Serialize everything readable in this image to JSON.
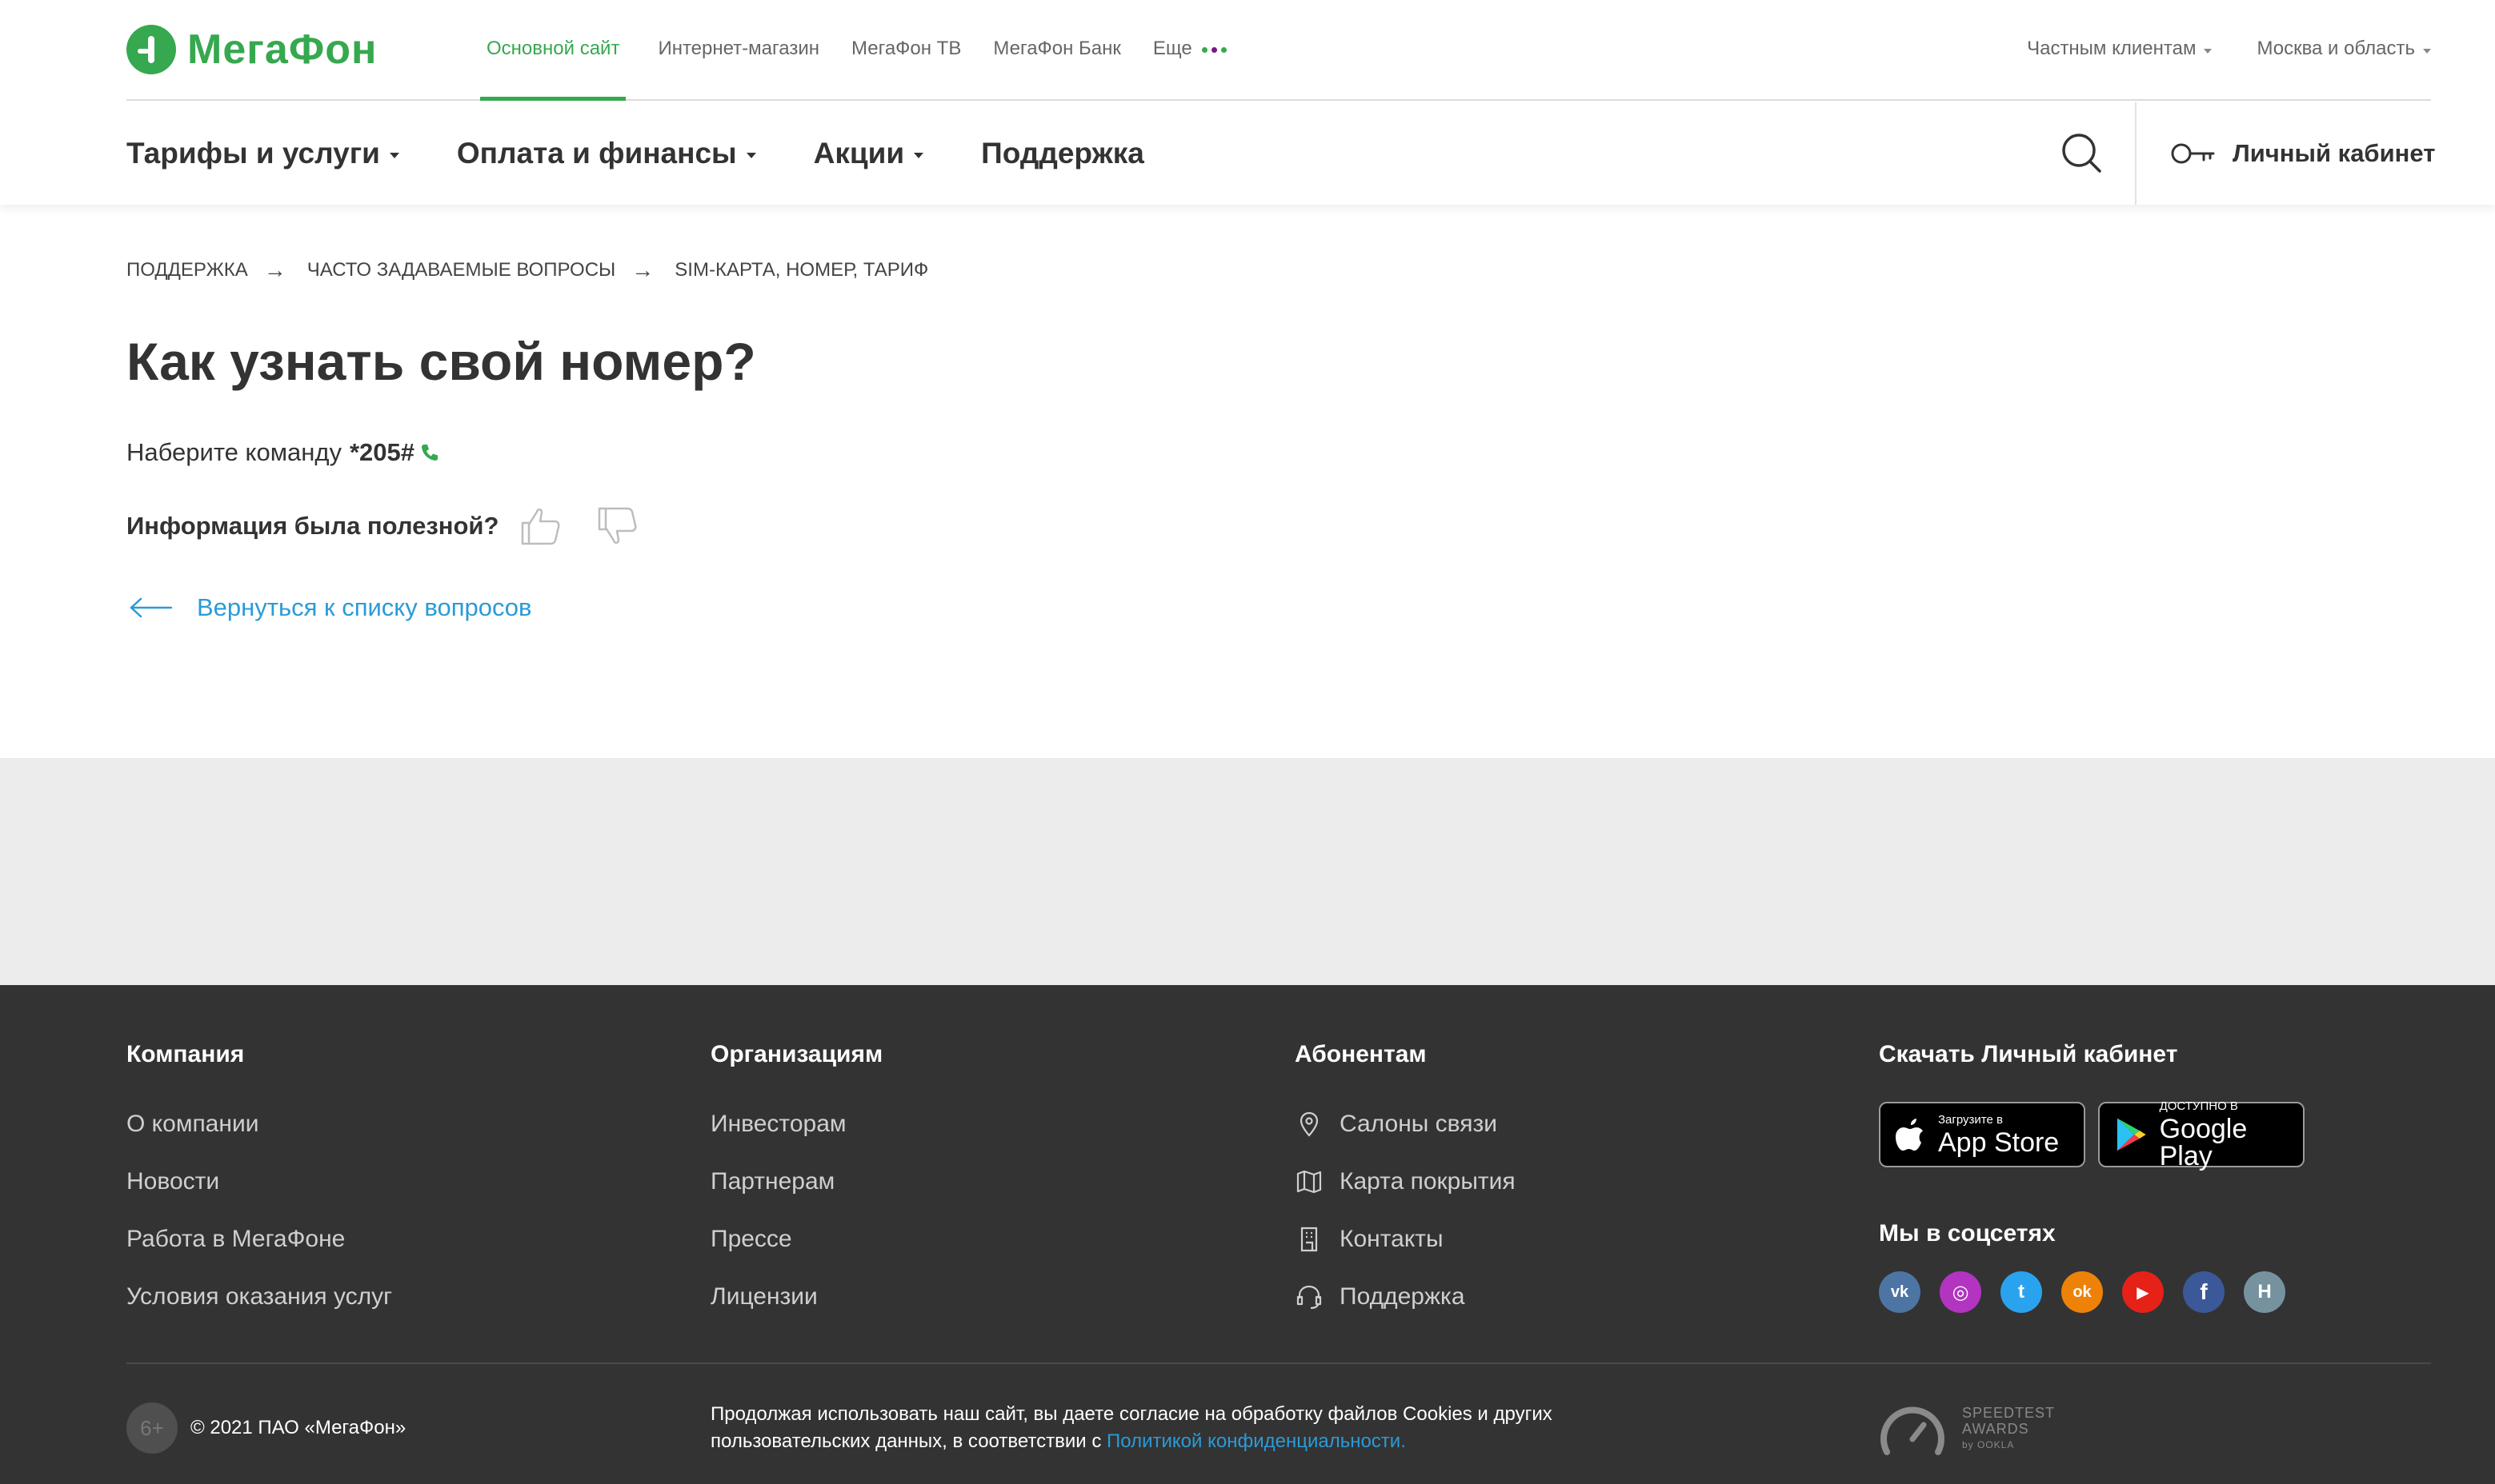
{
  "brand": {
    "name": "МегаФон",
    "green": "#36a84f",
    "purple": "#731982",
    "link_blue": "#2a9bd8"
  },
  "topnav": {
    "items": [
      "Основной сайт",
      "Интернет-магазин",
      "МегаФон ТВ",
      "МегаФон Банк",
      "Еще"
    ],
    "active": "Основной сайт"
  },
  "topright": {
    "segment": "Частным клиентам",
    "region": "Москва и область"
  },
  "mainnav": {
    "items": [
      "Тарифы и услуги",
      "Оплата и финансы",
      "Акции",
      "Поддержка"
    ],
    "account": "Личный кабинет"
  },
  "breadcrumb": [
    "ПОДДЕРЖКА",
    "ЧАСТО ЗАДАВАЕМЫЕ ВОПРОСЫ",
    "SIM-КАРТА, НОМЕР, ТАРИФ"
  ],
  "article": {
    "title": "Как узнать свой номер?",
    "answer_prefix": "Наберите команду",
    "command": "*205#",
    "feedback_question": "Информация была полезной?",
    "back_link": "Вернуться к списку вопросов"
  },
  "footer": {
    "columns": [
      {
        "title": "Компания",
        "links": [
          "О компании",
          "Новости",
          "Работа в МегаФоне",
          "Условия оказания услуг"
        ]
      },
      {
        "title": "Организациям",
        "links": [
          "Инвесторам",
          "Партнерам",
          "Прессе",
          "Лицензии"
        ]
      },
      {
        "title": "Абонентам",
        "links": [
          "Салоны связи",
          "Карта покрытия",
          "Контакты",
          "Поддержка"
        ]
      }
    ],
    "app_title": "Скачать Личный кабинет",
    "appstore": {
      "small": "Загрузите в",
      "big": "App Store"
    },
    "googleplay": {
      "small": "ДОСТУПНО В",
      "big": "Google Play"
    },
    "social_title": "Мы в соцсетях",
    "socials": [
      {
        "icon": "vk-icon",
        "glyph": "vk",
        "color": "#4c75a3"
      },
      {
        "icon": "instagram-icon",
        "glyph": "◎",
        "color": "#b234c0"
      },
      {
        "icon": "twitter-icon",
        "glyph": "t",
        "color": "#2aa3ef"
      },
      {
        "icon": "odnoklassniki-icon",
        "glyph": "ok",
        "color": "#ee8208"
      },
      {
        "icon": "youtube-icon",
        "glyph": "▶",
        "color": "#e62117"
      },
      {
        "icon": "facebook-icon",
        "glyph": "f",
        "color": "#3b5998"
      },
      {
        "icon": "habr-icon",
        "glyph": "H",
        "color": "#77929f"
      }
    ],
    "age": "6+",
    "copyright": "© 2021 ПАО «МегаФон»",
    "cookie_text": "Продолжая использовать наш сайт, вы даете согласие на обработку файлов Cookies и других пользовательских данных, в соответствии с ",
    "cookie_link": "Политикой конфиденциальности.",
    "speedtest": {
      "line1": "SPEEDTEST",
      "line2": "AWARDS",
      "line3": "by OOKLA"
    }
  }
}
